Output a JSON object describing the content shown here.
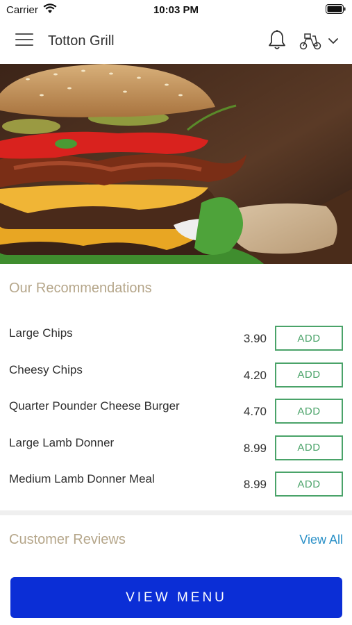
{
  "status_bar": {
    "carrier": "Carrier",
    "time": "10:03 PM"
  },
  "header": {
    "title": "Totton Grill",
    "icons": [
      "menu-icon",
      "bell-icon",
      "delivery-scooter-icon",
      "chevron-down-icon"
    ]
  },
  "hero": {
    "image": "burger-photo"
  },
  "recommendations": {
    "title": "Our Recommendations",
    "add_label": "ADD",
    "items": [
      {
        "name": "Large Chips",
        "price": "3.90"
      },
      {
        "name": "Cheesy Chips",
        "price": "4.20"
      },
      {
        "name": "Quarter Pounder Cheese Burger",
        "price": "4.70"
      },
      {
        "name": "Large Lamb Donner",
        "price": "8.99"
      },
      {
        "name": "Medium Lamb Donner Meal",
        "price": "8.99"
      }
    ]
  },
  "reviews": {
    "title": "Customer Reviews",
    "view_all": "View All"
  },
  "footer": {
    "view_menu": "VIEW MENU"
  },
  "colors": {
    "accent_green": "#4aa369",
    "section_title": "#b5a68a",
    "link_blue": "#2a90c7",
    "primary_button": "#0b2ed6"
  }
}
